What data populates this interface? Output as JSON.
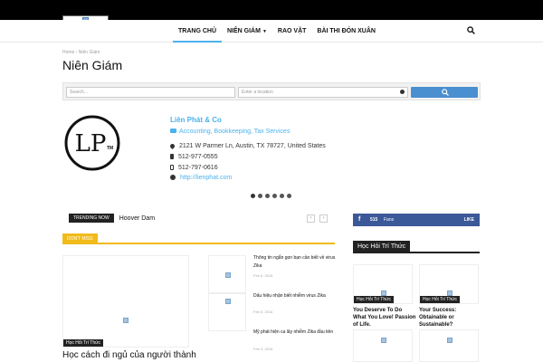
{
  "header": {
    "nav": [
      {
        "label": "TRANG CHỦ",
        "active": true
      },
      {
        "label": "NIÊN GIÁM",
        "has_dropdown": true
      },
      {
        "label": "RAO VẶT"
      },
      {
        "label": "BÀI THI ĐÓN XUÂN"
      }
    ],
    "search_icon": "search-icon"
  },
  "breadcrumb": {
    "home": "Home",
    "separator": "›",
    "current": "Niên Giám"
  },
  "page_title": "Niên Giám",
  "search": {
    "query_placeholder": "Search...",
    "location_placeholder": "Enter a location"
  },
  "listing": {
    "name": "Liên Phát & Co",
    "categories": "Accounting, Bookkeeping, Tax Services",
    "address": "2121 W Parmer Ln, Austin, TX 78727, United States",
    "phone": "512-977-0555",
    "mobile": "512-797-0616",
    "website": "http://lienphat.com",
    "logo_text": "LP",
    "logo_tm": "TM"
  },
  "slider": {
    "count": 6,
    "active_index": 0
  },
  "trending": {
    "badge": "TRENDING NOW",
    "text": "Hoover Dam",
    "prev": "‹",
    "next": "›"
  },
  "dont_miss": {
    "label": "DON'T MISS",
    "featured": {
      "category": "Học Hỏi Trí Thức",
      "title": "Học cách đi ngủ của người thành"
    },
    "posts": [
      {
        "title": "Thông tin ngắn gọn bạn cần biết về virus Zika",
        "date": "Feb 6, 2016"
      },
      {
        "title": "Dấu hiệu nhận biết nhiễm virus Zika",
        "date": "Feb 5, 2016"
      },
      {
        "title": "Mỹ phát hiện ca lây nhiễm Zika đầu tiên",
        "date": "Feb 3, 2016"
      }
    ]
  },
  "facebook": {
    "icon": "f",
    "count": "515",
    "label": "Fans",
    "action": "LIKE",
    "color": "#3b5998"
  },
  "hoc_hoi": {
    "label": "Học Hỏi Trí Thức",
    "items": [
      {
        "category": "Học Hỏi Trí Thức",
        "title": "You Deserve To Do What You Love! Passion of Life."
      },
      {
        "category": "Học Hỏi Trí Thức",
        "title": "Your Success: Obtainable or Sustainable?"
      }
    ]
  },
  "colors": {
    "accent": "#4db2ec",
    "dont_miss": "#f1bb1b",
    "search_button": "#4a8fd0"
  }
}
